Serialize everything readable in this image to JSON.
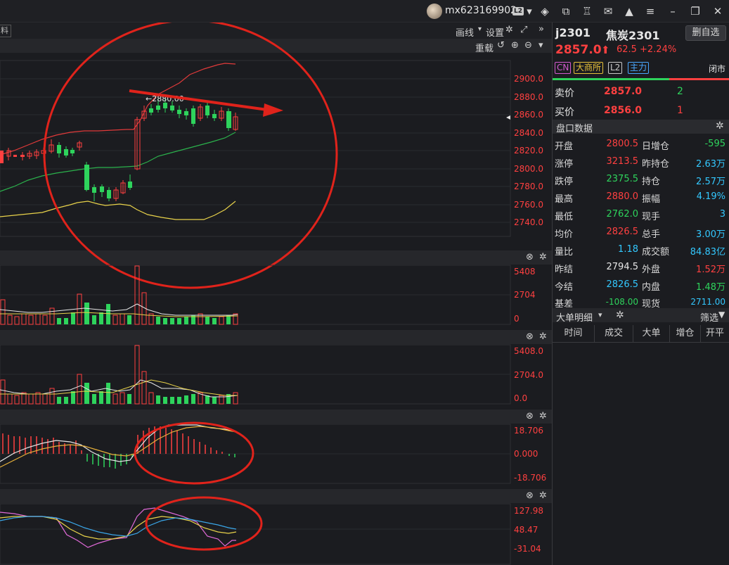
{
  "topbar": {
    "username": "mx623169902",
    "level_badge": "L2",
    "icons": [
      "dropdown-icon",
      "layers-icon",
      "window-link-icon",
      "shirt-icon",
      "mail-icon",
      "bell-icon",
      "menu-icon",
      "minimize-icon",
      "restore-icon",
      "close-icon"
    ]
  },
  "chart_toolbar": {
    "data_tab": "料",
    "draw_label": "画线",
    "settings_label": "设置",
    "reload_label": "重载"
  },
  "price_axis": [
    "2900.0",
    "2880.0",
    "2860.0",
    "2840.0",
    "2820.0",
    "2800.0",
    "2780.0",
    "2760.0",
    "2740.0"
  ],
  "high_marker": "2880.00",
  "vol_axis": [
    "5408",
    "2704",
    "0"
  ],
  "oi_axis": [
    "5408.0",
    "2704.0",
    "0.0"
  ],
  "macd_axis": [
    "18.706",
    "0.000",
    "-18.706"
  ],
  "kdj_axis": [
    "127.98",
    "48.47",
    "-31.04"
  ],
  "quote": {
    "code": "j2301",
    "name": "焦炭2301",
    "delete_btn": "删自选",
    "price": "2857.0",
    "change": "62.5",
    "change_pct": "+2.24%",
    "tags": [
      "CN",
      "大商所",
      "L2",
      "主力"
    ],
    "market_status": "闭市",
    "ask_label": "卖价",
    "ask_price": "2857.0",
    "ask_vol": "2",
    "bid_label": "买价",
    "bid_price": "2856.0",
    "bid_vol": "1",
    "section_title": "盘口数据",
    "rows": [
      {
        "l1": "开盘",
        "v1": "2800.5",
        "l2": "日增仓",
        "v2": "-595"
      },
      {
        "l1": "涨停",
        "v1": "3213.5",
        "l2": "昨持仓",
        "v2": "2.63万"
      },
      {
        "l1": "跌停",
        "v1": "2375.5",
        "l2": "持仓",
        "v2": "2.57万"
      },
      {
        "l1": "最高",
        "v1": "2880.0",
        "l2": "振幅",
        "v2": "4.19%"
      },
      {
        "l1": "最低",
        "v1": "2762.0",
        "l2": "现手",
        "v2": "3"
      },
      {
        "l1": "均价",
        "v1": "2826.5",
        "l2": "总手",
        "v2": "3.00万"
      },
      {
        "l1": "量比",
        "v1": "1.18",
        "l2": "成交额",
        "v2": "84.83亿"
      },
      {
        "l1": "昨结",
        "v1": "2794.5",
        "l2": "外盘",
        "v2": "1.52万"
      },
      {
        "l1": "今结",
        "v1": "2826.5",
        "l2": "内盘",
        "v2": "1.48万"
      },
      {
        "l1": "基差",
        "v1": "-108.00",
        "l2": "现货",
        "v2": "2711.00"
      }
    ],
    "big_order_title": "大单明细",
    "filter_label": "筛选",
    "columns": [
      "时间",
      "成交",
      "大单",
      "增仓",
      "开平"
    ]
  },
  "colors": {
    "up": "#ff4040",
    "down": "#2ed35c",
    "annotation": "#e0231b",
    "axis_text": "#ff4040",
    "bg": "#1b1c20"
  }
}
